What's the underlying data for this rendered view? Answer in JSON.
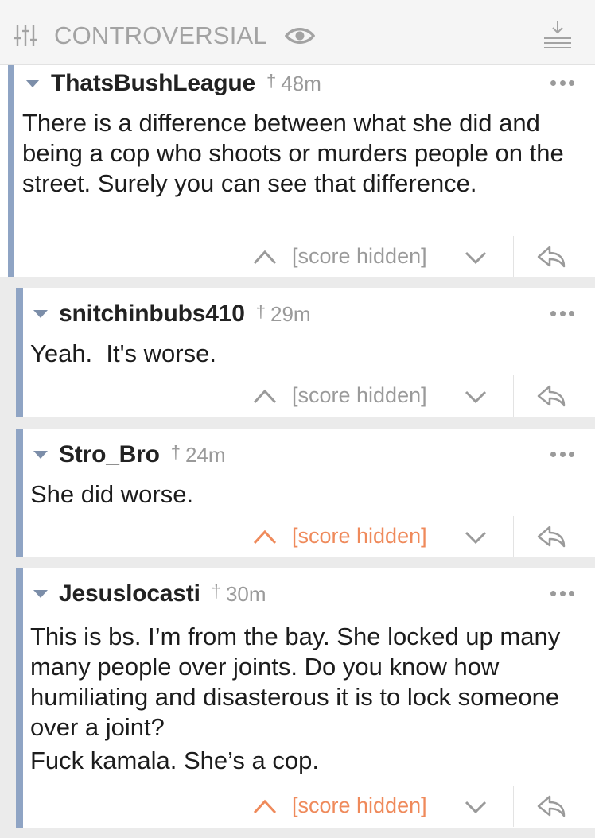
{
  "header": {
    "sort_icon": "sliders-icon",
    "sort_label": "CONTROVERSIAL",
    "visibility_icon": "eye-icon",
    "download_icon": "download-icon"
  },
  "colors": {
    "thread_bar": "#8fa4c4",
    "upvoted": "#ef8a5b",
    "muted": "#9a9a9a"
  },
  "comments": [
    {
      "user": "ThatsBushLeague",
      "dagger": "†",
      "time": "48m",
      "paragraphs": [
        "There is a difference between what she did and being a cop who shoots or murders people on the street. Surely you can see that difference."
      ],
      "score": "[score hidden]",
      "upvoted": false
    },
    {
      "user": "snitchinbubs410",
      "dagger": "†",
      "time": "29m",
      "paragraphs": [
        "Yeah.  It's worse."
      ],
      "score": "[score hidden]",
      "upvoted": false
    },
    {
      "user": "Stro_Bro",
      "dagger": "†",
      "time": "24m",
      "paragraphs": [
        "She did worse."
      ],
      "score": "[score hidden]",
      "upvoted": true
    },
    {
      "user": "Jesuslocasti",
      "dagger": "†",
      "time": "30m",
      "paragraphs": [
        "This is bs. I’m from the bay. She locked up many many people over joints. Do you know how humiliating and disasterous it is to lock someone over a joint?",
        "Fuck kamala. She’s a cop."
      ],
      "score": "[score hidden]",
      "upvoted": true
    }
  ]
}
